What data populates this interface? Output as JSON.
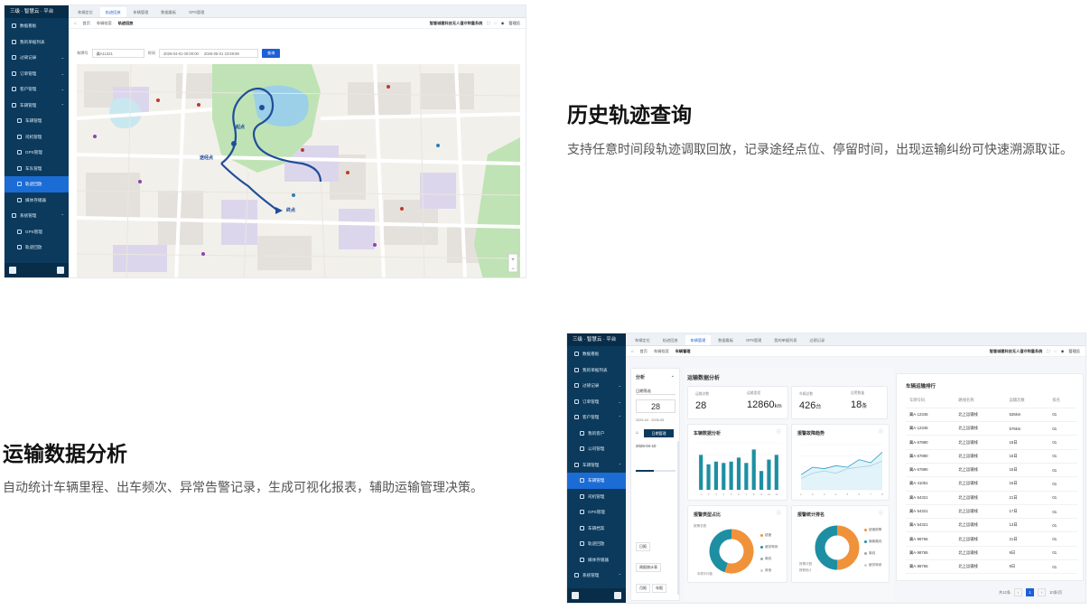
{
  "section1": {
    "heading": "历史轨迹查询",
    "description": "支持任意时间段轨迹调取回放，记录途经点位、停留时间，出现运输纠纷可快速溯源取证。"
  },
  "section2": {
    "heading": "运输数据分析",
    "description": "自动统计车辆里程、出车频次、异常告警记录，生成可视化报表，辅助运输管理决策。"
  },
  "shot1": {
    "app_title": "三级 · 智慧云 · 平台",
    "sidebar": [
      {
        "label": "数据看板",
        "sub": false,
        "active": false,
        "chev": ""
      },
      {
        "label": "我的单据列表",
        "sub": false,
        "active": false,
        "chev": ""
      },
      {
        "label": "过磅记录",
        "sub": false,
        "active": false,
        "chev": "⌄"
      },
      {
        "label": "订单管理",
        "sub": false,
        "active": false,
        "chev": "⌄"
      },
      {
        "label": "客户管理",
        "sub": false,
        "active": false,
        "chev": "⌄"
      },
      {
        "label": "车辆管理",
        "sub": false,
        "active": false,
        "chev": "⌃"
      },
      {
        "label": "车辆管理",
        "sub": true,
        "active": false,
        "chev": ""
      },
      {
        "label": "司机管理",
        "sub": true,
        "active": false,
        "chev": ""
      },
      {
        "label": "GPS管理",
        "sub": true,
        "active": false,
        "chev": ""
      },
      {
        "label": "车队管理",
        "sub": true,
        "active": false,
        "chev": ""
      },
      {
        "label": "轨迹回放",
        "sub": true,
        "active": true,
        "chev": ""
      },
      {
        "label": "媒体存储器",
        "sub": true,
        "active": false,
        "chev": ""
      },
      {
        "label": "系统管理",
        "sub": false,
        "active": false,
        "chev": "⌃"
      },
      {
        "label": "GPS管理",
        "sub": true,
        "active": false,
        "chev": ""
      },
      {
        "label": "轨迹回放",
        "sub": true,
        "active": false,
        "chev": ""
      }
    ],
    "tabs": [
      "车辆定位",
      "轨迹回放",
      "车辆管理",
      "数据看板",
      "GPS管理"
    ],
    "active_tab": 1,
    "breadcrumb": [
      "首页",
      "车辆档案",
      "轨迹回放"
    ],
    "company": "智慧城建科技无人值守称重系统",
    "user": "管理员",
    "filter": {
      "plate_label": "车牌号",
      "plate_value": "冀A11321",
      "time_label": "时间",
      "start": "2026-04-01 00:00:00",
      "end": "2026-05-01 23:59:59",
      "query": "查询"
    },
    "map_labels": {
      "start": "起点",
      "end": "终点",
      "mid": "途经点"
    }
  },
  "shot2": {
    "app_title": "三级 · 智慧云 · 平台",
    "sidebar": [
      {
        "label": "数据看板",
        "sub": false,
        "active": false,
        "chev": ""
      },
      {
        "label": "我的单据列表",
        "sub": false,
        "active": false,
        "chev": ""
      },
      {
        "label": "过磅记录",
        "sub": false,
        "active": false,
        "chev": "⌄"
      },
      {
        "label": "订单管理",
        "sub": false,
        "active": false,
        "chev": "⌄"
      },
      {
        "label": "客户管理",
        "sub": false,
        "active": false,
        "chev": "⌃"
      },
      {
        "label": "我的客户",
        "sub": true,
        "active": false,
        "chev": ""
      },
      {
        "label": "公司管理",
        "sub": true,
        "active": false,
        "chev": ""
      },
      {
        "label": "车辆管理",
        "sub": false,
        "active": false,
        "chev": "⌃"
      },
      {
        "label": "车辆管理",
        "sub": true,
        "active": true,
        "chev": ""
      },
      {
        "label": "司机管理",
        "sub": true,
        "active": false,
        "chev": ""
      },
      {
        "label": "GPS管理",
        "sub": true,
        "active": false,
        "chev": ""
      },
      {
        "label": "车辆档案",
        "sub": true,
        "active": false,
        "chev": ""
      },
      {
        "label": "轨迹回放",
        "sub": true,
        "active": false,
        "chev": ""
      },
      {
        "label": "媒体存储器",
        "sub": true,
        "active": false,
        "chev": ""
      },
      {
        "label": "系统管理",
        "sub": false,
        "active": false,
        "chev": "⌃"
      }
    ],
    "tabs": [
      "车辆定位",
      "轨迹回放",
      "车辆管理",
      "数据看板",
      "GPS管理",
      "我的单据列表",
      "过磅记录"
    ],
    "active_tab": 2,
    "breadcrumb": [
      "首页",
      "车辆档案",
      "车辆管理"
    ],
    "company": "智慧城建科技无人值守称重系统",
    "user": "管理员",
    "left_panel": {
      "title": "分析",
      "select": "日期筛选",
      "count": "28",
      "range_label": "2026-04 · 2026-05",
      "btn": "日期管理",
      "date": "2026-04-10",
      "tags": [
        "日报",
        "周报统计表",
        "月报",
        "年报"
      ]
    },
    "panel_title": "运输数据分析",
    "kpis": [
      {
        "label": "运输次数",
        "value": "28",
        "unit": ""
      },
      {
        "label": "运输里程",
        "value": "12860",
        "unit": "km"
      },
      {
        "label": "车辆总数",
        "value": "426",
        "unit": "台"
      },
      {
        "label": "告警数量",
        "value": "18",
        "unit": "条"
      }
    ],
    "chart_titles": {
      "bar": "车辆数据分析",
      "line": "报警故障趋势",
      "donut1": "报警类型占比",
      "donut2": "报警统计排名"
    },
    "donut1_center": "报警总数",
    "donut1_note": "本周平均值",
    "donut1_legend": [
      "超速",
      "疲劳驾驶",
      "离线",
      "其他"
    ],
    "donut2_center": "报警次数",
    "donut2_note": "报警统计",
    "donut2_legend": [
      "超速报警",
      "偏离路线",
      "离线",
      "疲劳驾驶"
    ],
    "rank": {
      "title": "车辆运输排行",
      "headers": [
        "车牌号码",
        "路线名称",
        "运输次数",
        "排名"
      ],
      "rows": [
        [
          "冀A·12345",
          "北上运输线",
          "526km",
          "01"
        ],
        [
          "冀A·12345",
          "北上运输线",
          "576km",
          "01"
        ],
        [
          "冀A·67890",
          "北上运输线",
          "18日",
          "01"
        ],
        [
          "冀A·67890",
          "北上运输线",
          "15日",
          "01"
        ],
        [
          "冀A·67890",
          "北上运输线",
          "15日",
          "01"
        ],
        [
          "冀A·41051",
          "北上运输线",
          "15日",
          "01"
        ],
        [
          "冀A·54321",
          "北上运输线",
          "21日",
          "01"
        ],
        [
          "冀A·54321",
          "北上运输线",
          "17日",
          "01"
        ],
        [
          "冀A·54321",
          "北上运输线",
          "13日",
          "01"
        ],
        [
          "冀A·98765",
          "北上运输线",
          "21日",
          "01"
        ],
        [
          "冀A·98765",
          "北上运输线",
          "9日",
          "01"
        ],
        [
          "冀A·98765",
          "北上运输线",
          "9日",
          "01"
        ]
      ]
    },
    "pagination": {
      "total": "共12条",
      "page": "1",
      "size": "10条/页"
    }
  },
  "colors": {
    "sidebar": "#0b3a5c",
    "active": "#1c6cd6",
    "teal": "#1e8fa3",
    "orange": "#f0923a",
    "route": "#1f4e9a"
  },
  "chart_data": [
    {
      "type": "bar",
      "categories": [
        "1",
        "2",
        "3",
        "4",
        "5",
        "6",
        "7",
        "8",
        "9",
        "10",
        "11"
      ],
      "values": [
        52,
        38,
        42,
        40,
        42,
        48,
        40,
        60,
        28,
        45,
        52
      ],
      "ylim": [
        0,
        70
      ]
    },
    {
      "type": "line",
      "x": [
        "1",
        "2",
        "3",
        "4",
        "5",
        "6",
        "7",
        "8"
      ],
      "series": [
        {
          "values": [
            20,
            30,
            28,
            32,
            30,
            40,
            36,
            50
          ]
        },
        {
          "values": [
            15,
            22,
            25,
            22,
            28,
            30,
            32,
            38
          ]
        }
      ],
      "ylim": [
        0,
        60
      ]
    },
    {
      "type": "pie",
      "labels": [
        "超速",
        "疲劳驾驶",
        "离线",
        "其他"
      ],
      "values": [
        55,
        45,
        0,
        0
      ]
    },
    {
      "type": "pie",
      "labels": [
        "超速报警",
        "偏离路线",
        "离线",
        "疲劳驾驶"
      ],
      "values": [
        50,
        50,
        0,
        0
      ]
    }
  ]
}
